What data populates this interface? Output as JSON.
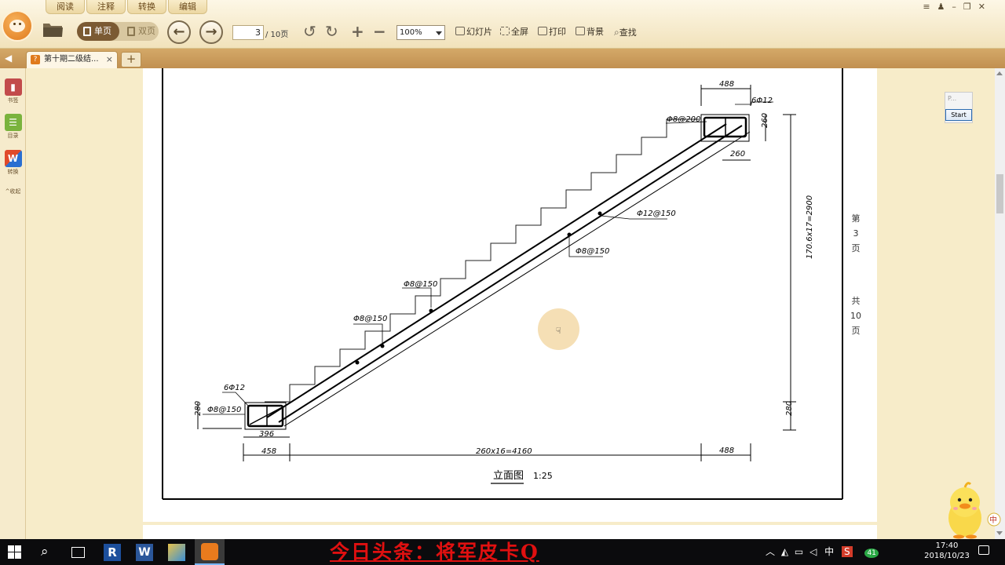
{
  "menu_tabs": [
    "阅读",
    "注释",
    "转换",
    "编辑"
  ],
  "toolbar": {
    "single_page": "单页",
    "double_page": "双页",
    "page_current": "3",
    "page_total": "/ 10页",
    "zoom": "100%",
    "slideshow": "幻灯片",
    "fullscreen": "全屏",
    "print": "打印",
    "background": "背景",
    "find": "查找"
  },
  "tab": {
    "title": "第十期二级结...",
    "close": "×",
    "add": "+"
  },
  "sidebar": {
    "bookmark": "书签",
    "toc": "目录",
    "convert": "转换",
    "collapse": "^收起"
  },
  "drawing": {
    "dims": {
      "top_width": "488",
      "top_bars": "6Φ12",
      "top_stirrup": "Φ8@200",
      "top_height": "260",
      "top_bottom": "260",
      "upper_rebar": "Φ12@150",
      "mid_stirrup": "Φ8@150",
      "label_a": "Φ8@150",
      "label_b": "Φ8@150",
      "bottom_bars": "6Φ12",
      "bottom_stirrup": "Φ8@150",
      "bottom_height": "280",
      "bottom_inner": "396",
      "bottom_left": "458",
      "run": "260x16=4160",
      "right_top": "488",
      "rise": "170.6x17=2900",
      "right_bottom": "280"
    },
    "title": "立面图",
    "scale": "1:25",
    "page_no": [
      "第",
      "3",
      "页"
    ],
    "page_total": [
      "共",
      "10",
      "页"
    ]
  },
  "overlay": {
    "mini_label": "P...",
    "start_button": "Start"
  },
  "watermark": "今日头条：将军皮卡Q",
  "tray": {
    "ime": "中",
    "badge": "41",
    "time": "17:40",
    "date": "2018/10/23"
  }
}
